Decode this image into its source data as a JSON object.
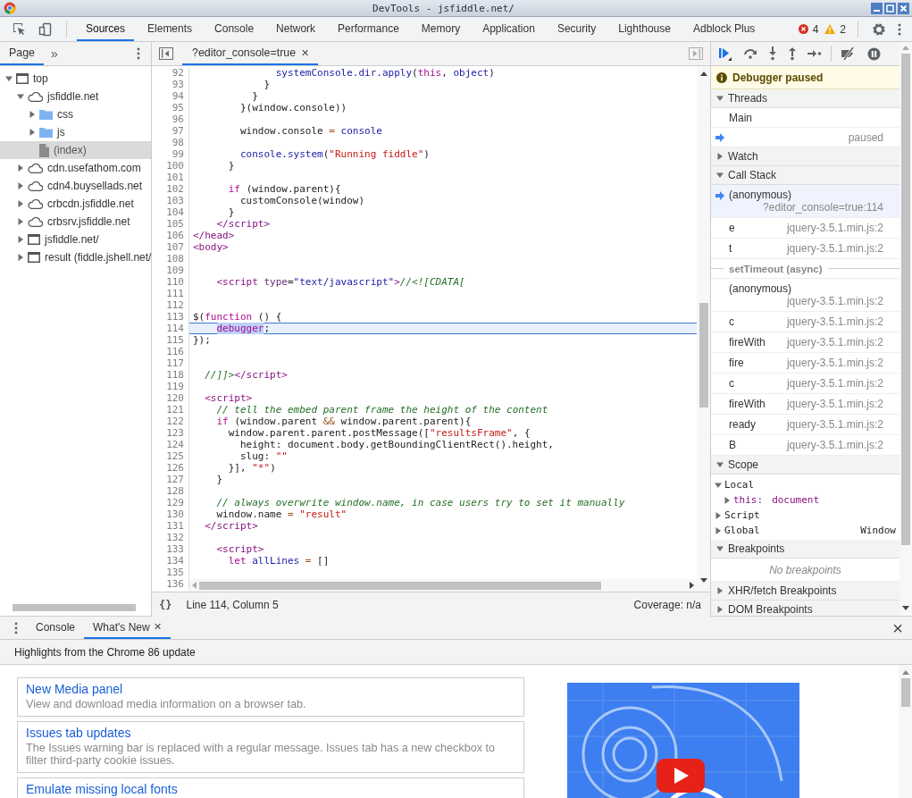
{
  "window": {
    "title": "DevTools - jsfiddle.net/"
  },
  "toolbar": {
    "tabs": [
      {
        "label": "Sources",
        "selected": true
      },
      {
        "label": "Elements",
        "selected": false
      },
      {
        "label": "Console",
        "selected": false
      },
      {
        "label": "Network",
        "selected": false
      },
      {
        "label": "Performance",
        "selected": false
      },
      {
        "label": "Memory",
        "selected": false
      },
      {
        "label": "Application",
        "selected": false
      },
      {
        "label": "Security",
        "selected": false
      },
      {
        "label": "Lighthouse",
        "selected": false
      },
      {
        "label": "Adblock Plus",
        "selected": false
      }
    ],
    "errors": "4",
    "warnings": "2"
  },
  "navigator": {
    "tabs": [
      {
        "label": "Page",
        "selected": true
      }
    ],
    "more": "»",
    "tree": [
      {
        "label": "top",
        "kind": "frame",
        "expanded": true,
        "selected": false,
        "children": [
          {
            "label": "jsfiddle.net",
            "kind": "domain",
            "expanded": true,
            "selected": false,
            "children": [
              {
                "label": "css",
                "kind": "folder",
                "expanded": false,
                "selected": false
              },
              {
                "label": "js",
                "kind": "folder",
                "expanded": false,
                "selected": false
              },
              {
                "label": "(index)",
                "kind": "file",
                "selected": true
              }
            ]
          },
          {
            "label": "cdn.usefathom.com",
            "kind": "domain",
            "expanded": false,
            "selected": false
          },
          {
            "label": "cdn4.buysellads.net",
            "kind": "domain",
            "expanded": false,
            "selected": false
          },
          {
            "label": "crbcdn.jsfiddle.net",
            "kind": "domain",
            "expanded": false,
            "selected": false
          },
          {
            "label": "crbsrv.jsfiddle.net",
            "kind": "domain",
            "expanded": false,
            "selected": false
          },
          {
            "label": "jsfiddle.net/",
            "kind": "frame",
            "expanded": false,
            "selected": false
          },
          {
            "label": "result (fiddle.jshell.net/",
            "kind": "frame",
            "expanded": false,
            "selected": false
          }
        ]
      }
    ]
  },
  "editor": {
    "tabs": [
      {
        "label": "?editor_console=true",
        "close": "✕",
        "selected": true
      }
    ],
    "lines": [
      {
        "n": "92",
        "current": false,
        "tokens": [
          {
            "kind": "variable",
            "text": "              systemConsole.dir.apply"
          },
          {
            "kind": "plain",
            "text": "("
          },
          {
            "kind": "keyword",
            "text": "this"
          },
          {
            "kind": "plain",
            "text": ", "
          },
          {
            "kind": "variable",
            "text": "object"
          },
          {
            "kind": "plain",
            "text": ")"
          }
        ]
      },
      {
        "n": "93",
        "current": false,
        "tokens": [
          {
            "kind": "plain",
            "text": "            }"
          }
        ]
      },
      {
        "n": "94",
        "current": false,
        "tokens": [
          {
            "kind": "plain",
            "text": "          }"
          }
        ]
      },
      {
        "n": "95",
        "current": false,
        "tokens": [
          {
            "kind": "plain",
            "text": "        }(window.console))"
          }
        ]
      },
      {
        "n": "96",
        "current": false
      },
      {
        "n": "97",
        "current": false,
        "tokens": [
          {
            "kind": "plain",
            "text": "        window.console "
          },
          {
            "kind": "operator",
            "text": "="
          },
          {
            "kind": "variable",
            "text": " console"
          }
        ]
      },
      {
        "n": "98",
        "current": false
      },
      {
        "n": "99",
        "current": false,
        "tokens": [
          {
            "kind": "variable",
            "text": "        console.system"
          },
          {
            "kind": "plain",
            "text": "("
          },
          {
            "kind": "string",
            "text": "\"Running fiddle\""
          },
          {
            "kind": "plain",
            "text": ")"
          }
        ]
      },
      {
        "n": "100",
        "current": false,
        "tokens": [
          {
            "kind": "plain",
            "text": "      }"
          }
        ]
      },
      {
        "n": "101",
        "current": false
      },
      {
        "n": "102",
        "current": false,
        "tokens": [
          {
            "kind": "keyword",
            "text": "      if"
          },
          {
            "kind": "plain",
            "text": " (window.parent){"
          }
        ]
      },
      {
        "n": "103",
        "current": false,
        "tokens": [
          {
            "kind": "plain",
            "text": "        customConsole(window)"
          }
        ]
      },
      {
        "n": "104",
        "current": false,
        "tokens": [
          {
            "kind": "plain",
            "text": "      }"
          }
        ]
      },
      {
        "n": "105",
        "current": false,
        "tokens": [
          {
            "kind": "tag",
            "text": "    </script>"
          }
        ]
      },
      {
        "n": "106",
        "current": false,
        "tokens": [
          {
            "kind": "tag",
            "text": "</head>"
          }
        ]
      },
      {
        "n": "107",
        "current": false,
        "tokens": [
          {
            "kind": "tag",
            "text": "<body>"
          }
        ]
      },
      {
        "n": "108",
        "current": false
      },
      {
        "n": "109",
        "current": false
      },
      {
        "n": "110",
        "current": false,
        "tokens": [
          {
            "kind": "tag",
            "text": "    <script"
          },
          {
            "kind": "attribute",
            "text": " type"
          },
          {
            "kind": "plain",
            "text": "="
          },
          {
            "kind": "variable",
            "text": "\"text/javascript\""
          },
          {
            "kind": "tag",
            "text": ">"
          },
          {
            "kind": "comment",
            "text": "//<![CDATA["
          }
        ]
      },
      {
        "n": "111",
        "current": false
      },
      {
        "n": "112",
        "current": false
      },
      {
        "n": "113",
        "current": false,
        "tokens": [
          {
            "kind": "plain",
            "text": "$("
          },
          {
            "kind": "keyword",
            "text": "function"
          },
          {
            "kind": "plain",
            "text": " () {"
          }
        ]
      },
      {
        "n": "114",
        "current": true,
        "tokens": [
          {
            "kind": "highlight",
            "text": "    debugger"
          },
          {
            "kind": "plain",
            "text": ";"
          }
        ]
      },
      {
        "n": "115",
        "current": false,
        "tokens": [
          {
            "kind": "plain",
            "text": "});"
          }
        ]
      },
      {
        "n": "116",
        "current": false
      },
      {
        "n": "117",
        "current": false
      },
      {
        "n": "118",
        "current": false,
        "tokens": [
          {
            "kind": "comment",
            "text": "  //]]>"
          },
          {
            "kind": "tag",
            "text": "</script>"
          }
        ]
      },
      {
        "n": "119",
        "current": false
      },
      {
        "n": "120",
        "current": false,
        "tokens": [
          {
            "kind": "tag",
            "text": "  <script>"
          }
        ]
      },
      {
        "n": "121",
        "current": false,
        "tokens": [
          {
            "kind": "comment",
            "text": "    // tell the embed parent frame the height of the content"
          }
        ]
      },
      {
        "n": "122",
        "current": false,
        "tokens": [
          {
            "kind": "keyword",
            "text": "    if"
          },
          {
            "kind": "plain",
            "text": " (window.parent "
          },
          {
            "kind": "operator",
            "text": "&&"
          },
          {
            "kind": "plain",
            "text": " window.parent.parent){"
          }
        ]
      },
      {
        "n": "123",
        "current": false,
        "tokens": [
          {
            "kind": "plain",
            "text": "      window.parent.parent.postMessage(["
          },
          {
            "kind": "string",
            "text": "\"resultsFrame\""
          },
          {
            "kind": "plain",
            "text": ", {"
          }
        ]
      },
      {
        "n": "124",
        "current": false,
        "tokens": [
          {
            "kind": "plain",
            "text": "        height: document.body.getBoundingClientRect().height,"
          }
        ]
      },
      {
        "n": "125",
        "current": false,
        "tokens": [
          {
            "kind": "plain",
            "text": "        slug: "
          },
          {
            "kind": "string",
            "text": "\"\""
          }
        ]
      },
      {
        "n": "126",
        "current": false,
        "tokens": [
          {
            "kind": "plain",
            "text": "      }], "
          },
          {
            "kind": "string",
            "text": "\"*\""
          },
          {
            "kind": "plain",
            "text": ")"
          }
        ]
      },
      {
        "n": "127",
        "current": false,
        "tokens": [
          {
            "kind": "plain",
            "text": "    }"
          }
        ]
      },
      {
        "n": "128",
        "current": false
      },
      {
        "n": "129",
        "current": false,
        "tokens": [
          {
            "kind": "comment",
            "text": "    // always overwrite window.name, in case users try to set it manually"
          }
        ]
      },
      {
        "n": "130",
        "current": false,
        "tokens": [
          {
            "kind": "plain",
            "text": "    window.name "
          },
          {
            "kind": "operator",
            "text": "="
          },
          {
            "kind": "string",
            "text": " \"result\""
          }
        ]
      },
      {
        "n": "131",
        "current": false,
        "tokens": [
          {
            "kind": "tag",
            "text": "  </script>"
          }
        ]
      },
      {
        "n": "132",
        "current": false
      },
      {
        "n": "133",
        "current": false,
        "tokens": [
          {
            "kind": "tag",
            "text": "    <script>"
          }
        ]
      },
      {
        "n": "134",
        "current": false,
        "tokens": [
          {
            "kind": "keyword",
            "text": "      let"
          },
          {
            "kind": "variable",
            "text": " allLines"
          },
          {
            "kind": "operator",
            "text": " ="
          },
          {
            "kind": "plain",
            "text": " []"
          }
        ]
      },
      {
        "n": "135",
        "current": false
      },
      {
        "n": "136",
        "current": false
      }
    ],
    "status": {
      "format": "{}",
      "position": "Line 114, Column 5",
      "coverage": "Coverage: n/a"
    }
  },
  "debugger": {
    "banner": "Debugger paused",
    "sections": [
      {
        "kind": "threads",
        "title": "Threads",
        "expanded": true,
        "threads": [
          {
            "name": "Main",
            "status": "paused",
            "selected": true
          }
        ]
      },
      {
        "title": "Watch",
        "expanded": false
      },
      {
        "kind": "callstack",
        "title": "Call Stack",
        "expanded": true,
        "frames": [
          {
            "kind": "frame",
            "function": "(anonymous)",
            "location": "?editor_console=true:114",
            "selected": true
          },
          {
            "kind": "frame",
            "function": "e",
            "location": "jquery-3.5.1.min.js:2",
            "selected": false
          },
          {
            "kind": "frame",
            "function": "t",
            "location": "jquery-3.5.1.min.js:2",
            "selected": false
          },
          {
            "kind": "async",
            "label": "setTimeout (async)"
          },
          {
            "kind": "frame",
            "function": "(anonymous)",
            "location": "jquery-3.5.1.min.js:2",
            "selected": false
          },
          {
            "kind": "frame",
            "function": "c",
            "location": "jquery-3.5.1.min.js:2",
            "selected": false
          },
          {
            "kind": "frame",
            "function": "fireWith",
            "location": "jquery-3.5.1.min.js:2",
            "selected": false
          },
          {
            "kind": "frame",
            "function": "fire",
            "location": "jquery-3.5.1.min.js:2",
            "selected": false
          },
          {
            "kind": "frame",
            "function": "c",
            "location": "jquery-3.5.1.min.js:2",
            "selected": false
          },
          {
            "kind": "frame",
            "function": "fireWith",
            "location": "jquery-3.5.1.min.js:2",
            "selected": false
          },
          {
            "kind": "frame",
            "function": "ready",
            "location": "jquery-3.5.1.min.js:2",
            "selected": false
          },
          {
            "kind": "frame",
            "function": "B",
            "location": "jquery-3.5.1.min.js:2",
            "selected": false
          }
        ]
      },
      {
        "kind": "scope",
        "title": "Scope",
        "expanded": true,
        "scopes": [
          {
            "name": "Local",
            "expanded": true,
            "children": [
              {
                "name": "this:",
                "value": "document",
                "expanded": false
              }
            ]
          },
          {
            "name": "Script",
            "expanded": false
          },
          {
            "name": "Global",
            "expanded": false,
            "value": "Window"
          }
        ]
      },
      {
        "kind": "breakpoints",
        "title": "Breakpoints",
        "expanded": true,
        "empty": "No breakpoints"
      },
      {
        "title": "XHR/fetch Breakpoints",
        "expanded": false
      },
      {
        "title": "DOM Breakpoints",
        "expanded": false
      }
    ]
  },
  "drawer": {
    "tabs": [
      {
        "label": "Console",
        "selected": false
      },
      {
        "label": "What's New",
        "close": "✕",
        "selected": true
      }
    ],
    "close": "×",
    "headline": "Highlights from the Chrome 86 update",
    "cards": [
      {
        "title": "New Media panel",
        "description": "View and download media information on a browser tab."
      },
      {
        "title": "Issues tab updates",
        "description": "The Issues warning bar is replaced with a regular message. Issues tab has a new checkbox to filter third-party cookie issues."
      },
      {
        "title": "Emulate missing local fonts"
      }
    ]
  }
}
